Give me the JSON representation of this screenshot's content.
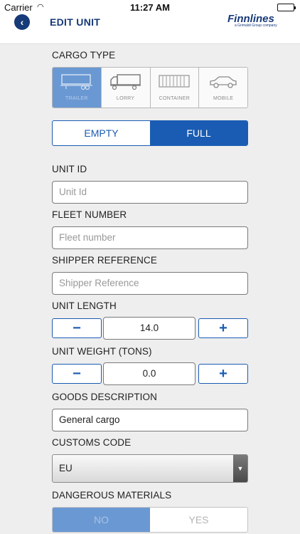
{
  "status": {
    "carrier": "Carrier",
    "time": "11:27 AM"
  },
  "nav": {
    "title": "EDIT UNIT",
    "brand": "Finnlines",
    "brand_sub": "a Grimaldi Group company"
  },
  "cargo_type": {
    "label": "CARGO TYPE",
    "options": [
      {
        "label": "TRAILER",
        "icon": "trailer-icon",
        "selected": true
      },
      {
        "label": "LORRY",
        "icon": "lorry-icon",
        "selected": false
      },
      {
        "label": "CONTAINER",
        "icon": "container-icon",
        "selected": false
      },
      {
        "label": "MOBILE",
        "icon": "car-icon",
        "selected": false
      }
    ]
  },
  "load": {
    "empty_label": "EMPTY",
    "full_label": "FULL",
    "selected": "FULL"
  },
  "unit_id": {
    "label": "UNIT ID",
    "value": "",
    "placeholder": "Unit Id"
  },
  "fleet_number": {
    "label": "FLEET NUMBER",
    "value": "",
    "placeholder": "Fleet number"
  },
  "shipper_reference": {
    "label": "SHIPPER REFERENCE",
    "value": "",
    "placeholder": "Shipper Reference"
  },
  "unit_length": {
    "label": "UNIT LENGTH",
    "value": "14.0",
    "minus": "−",
    "plus": "+"
  },
  "unit_weight": {
    "label": "UNIT WEIGHT (TONS)",
    "value": "0.0",
    "minus": "−",
    "plus": "+"
  },
  "goods_description": {
    "label": "GOODS DESCRIPTION",
    "value": "General cargo"
  },
  "customs_code": {
    "label": "CUSTOMS CODE",
    "value": "EU"
  },
  "dangerous_materials": {
    "label": "DANGEROUS MATERIALS",
    "no_label": "NO",
    "yes_label": "YES",
    "selected": "NO"
  },
  "colors": {
    "accent": "#1a5cb3",
    "brand_navy": "#173a78",
    "selected_muted": "#6a98d3"
  }
}
